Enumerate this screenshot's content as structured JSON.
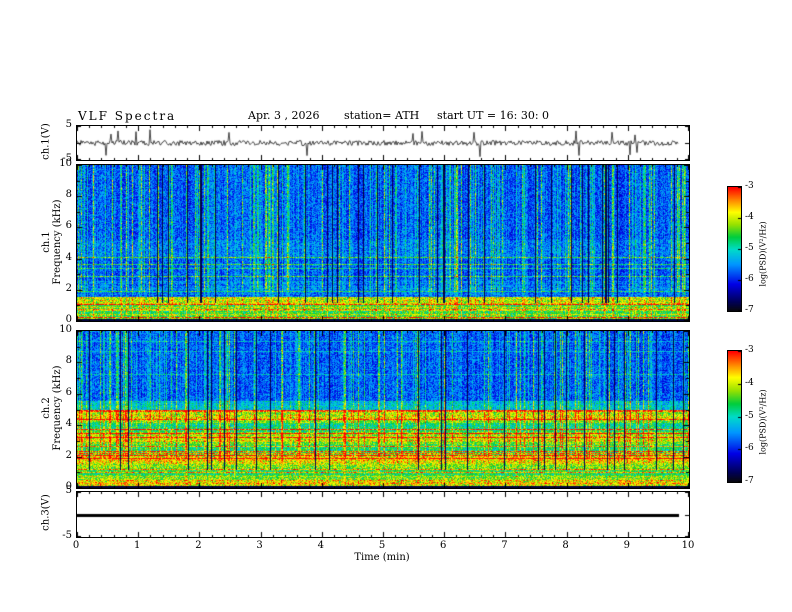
{
  "header": {
    "title": "VLF  Spectra",
    "date": "Apr. 3  , 2026",
    "station": "station= ATH",
    "start_ut": "start UT =   16: 30: 0"
  },
  "panels": {
    "wave1": {
      "label": "ch.1(V)",
      "y_ticks": [
        "5",
        "-5"
      ]
    },
    "spec1": {
      "label_line1": "ch.1",
      "label_line2": "Frequency  (kHz)",
      "y_ticks": [
        "10",
        "8",
        "6",
        "4",
        "2",
        "0"
      ]
    },
    "spec2": {
      "label_line1": "ch.2",
      "label_line2": "Frequency  (kHz)",
      "y_ticks": [
        "10",
        "8",
        "6",
        "4",
        "2",
        "0"
      ]
    },
    "wave3": {
      "label": "ch.3(V)",
      "y_ticks": [
        "5",
        "-5"
      ]
    }
  },
  "xaxis": {
    "label": "Time  (min)",
    "ticks": [
      "0",
      "1",
      "2",
      "3",
      "4",
      "5",
      "6",
      "7",
      "8",
      "9",
      "10"
    ]
  },
  "colorbar": {
    "label": "log(PSD)(V²/Hz)",
    "ticks": [
      "-3",
      "-4",
      "-5",
      "-6",
      "-7"
    ],
    "range": [
      -7,
      -3
    ],
    "colors_top_to_bottom": [
      "#ff0000",
      "#ff8200",
      "#ffff00",
      "#00cd3c",
      "#00dcc8",
      "#0096ff",
      "#0000e6",
      "#00005a",
      "#000000"
    ]
  },
  "chart_data": [
    {
      "type": "line",
      "title": "ch.1(V) broadband waveform",
      "xlabel": "Time (min)",
      "ylabel": "ch.1(V)",
      "xlim": [
        0,
        10
      ],
      "ylim": [
        -5,
        5
      ],
      "description": "Continuous broadband noise centred on 0 V, typical amplitude about ±1 V, with sparse impulsive sferic spikes reaching roughly ±4 V across the full 10 minutes"
    },
    {
      "type": "heatmap",
      "title": "ch.1 VLF spectrogram",
      "xlabel": "Time (min)",
      "ylabel": "Frequency (kHz)",
      "xlim": [
        0,
        10
      ],
      "ylim": [
        0,
        10
      ],
      "zlabel": "log(PSD)(V²/Hz)",
      "zlim": [
        -7,
        -3
      ],
      "legend_position": "right colorbar",
      "features": [
        "blue background near -6 log(PSD) above ~2 kHz",
        "dense cyan-green vertical sferic streaks spanning 2-10 kHz at all times",
        "scattered darker (near -7) vertical dropout columns",
        "narrow cyan horizontal lines between about 2 and 4 kHz",
        "slightly elevated blue band near 4-5 kHz",
        "bright green-yellow band with intermittent red lines below ~1.5 kHz",
        "dark row at the 0 kHz edge"
      ]
    },
    {
      "type": "heatmap",
      "title": "ch.2 VLF spectrogram",
      "xlabel": "Time (min)",
      "ylabel": "Frequency (kHz)",
      "xlim": [
        0,
        10
      ],
      "ylim": [
        0,
        10
      ],
      "zlabel": "log(PSD)(V²/Hz)",
      "zlim": [
        -7,
        -3
      ],
      "legend_position": "right colorbar",
      "features": [
        "blue background with cyan-green vertical sferic streaks above ~5.5 kHz",
        "strong steady horizontal interference banding from 0 to ~5 kHz in green, yellow, orange and red",
        "brighter cyan transition band near 5-5.6 kHz",
        "dark row at the 0 kHz edge"
      ]
    },
    {
      "type": "line",
      "title": "ch.3(V) waveform",
      "xlabel": "Time (min)",
      "ylabel": "ch.3(V)",
      "xlim": [
        0,
        10
      ],
      "ylim": [
        -5,
        5
      ],
      "description": "Constant flat trace at 0 V for the whole record (thick black line, channel inactive)"
    }
  ]
}
